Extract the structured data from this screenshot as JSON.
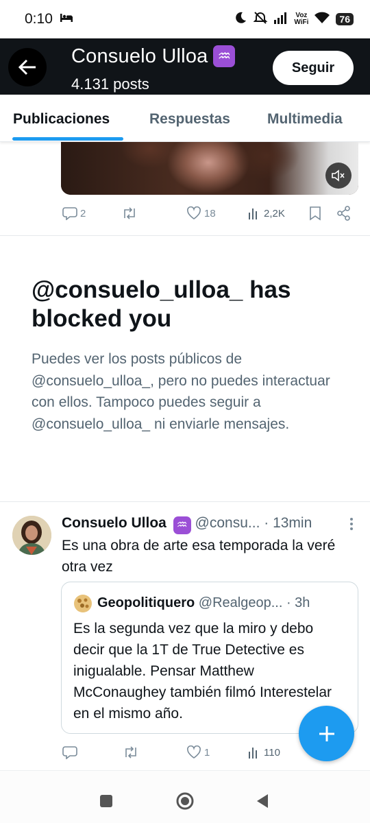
{
  "status_bar": {
    "time": "0:10",
    "voz_top": "Voz",
    "voz_bottom": "WiFi",
    "battery": "76"
  },
  "header": {
    "name": "Consuelo Ulloa",
    "zodiac_emoji": "♒",
    "posts": "4.131 posts",
    "follow_label": "Seguir"
  },
  "tabs": [
    {
      "label": "Publicaciones",
      "active": true
    },
    {
      "label": "Respuestas",
      "active": false
    },
    {
      "label": "Multimedia",
      "active": false
    }
  ],
  "prev_post": {
    "replies": "2",
    "reposts": "",
    "likes": "18",
    "views": "2,2K"
  },
  "blocked": {
    "title": "@consuelo_ulloa_ has blocked you",
    "description": "Puedes ver los posts públicos de @consuelo_ulloa_, pero no puedes interactuar con ellos. Tampoco puedes seguir a @consuelo_ulloa_ ni enviarle mensajes."
  },
  "tweet": {
    "name": "Consuelo Ulloa",
    "zodiac_emoji": "♒",
    "handle": "@consu...",
    "time": "· 13min",
    "text": "Es una obra de arte esa temporada la veré otra vez",
    "quote": {
      "name": "Geopolitiquero",
      "handle": "@Realgeop...",
      "time": "· 3h",
      "text": "Es la segunda vez que la miro y debo decir que la 1T de True Detective es inigualable. Pensar Matthew McConaughey también filmó Interestelar en el mismo año."
    },
    "replies": "",
    "reposts": "",
    "likes": "1",
    "views": "110"
  },
  "colors": {
    "accent": "#1d9bf0",
    "zodiac": "#9b4fd6",
    "header_bg": "#101418",
    "secondary_text": "#536471"
  }
}
